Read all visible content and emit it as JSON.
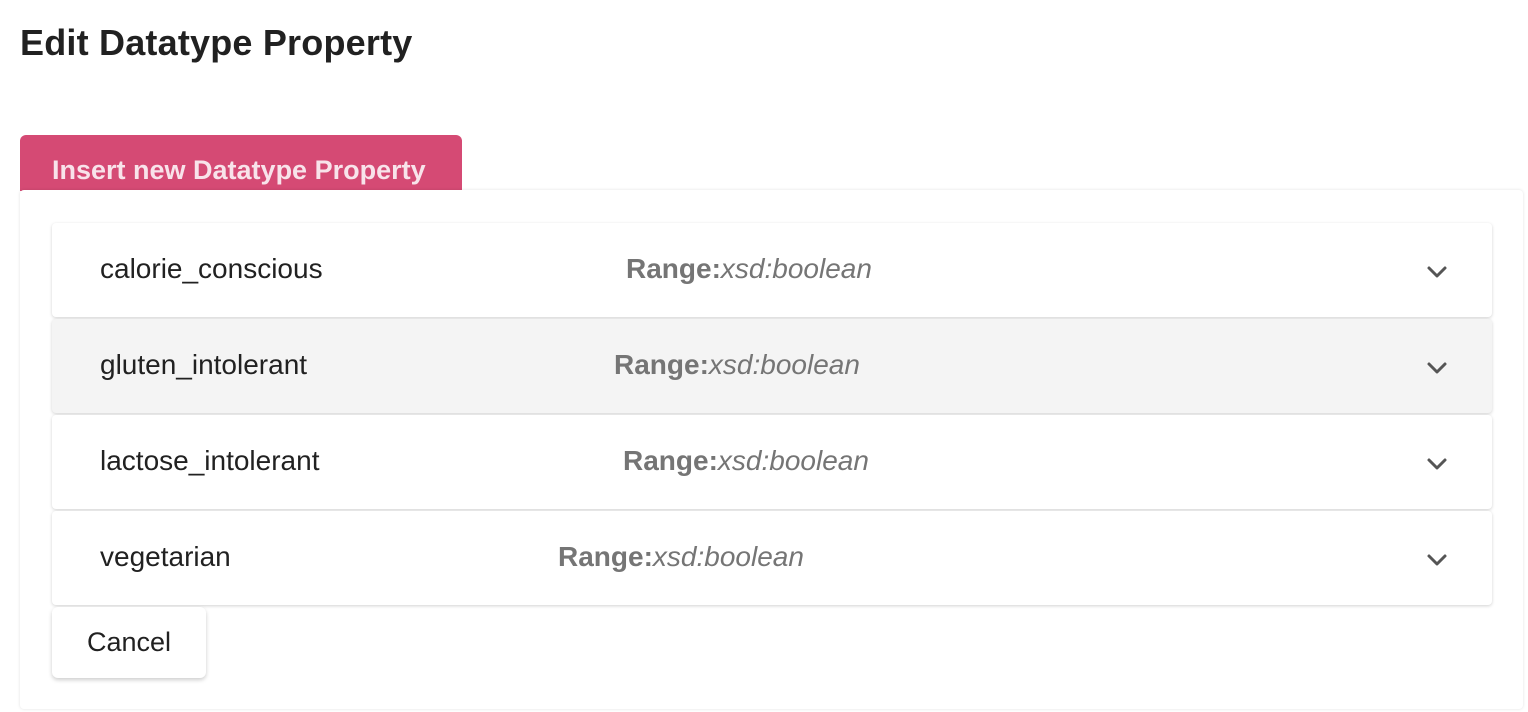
{
  "header": {
    "title": "Edit Datatype Property"
  },
  "toolbar": {
    "insert_label": "Insert new Datatype Property"
  },
  "properties": [
    {
      "name": "calorie_conscious",
      "range_label": "Range:",
      "range_value": "xsd:boolean",
      "icon": "chevron-down-icon"
    },
    {
      "name": "gluten_intolerant",
      "range_label": "Range:",
      "range_value": "xsd:boolean",
      "icon": "chevron-down-icon"
    },
    {
      "name": "lactose_intolerant",
      "range_label": "Range:",
      "range_value": "xsd:boolean",
      "icon": "chevron-down-icon"
    },
    {
      "name": "vegetarian",
      "range_label": "Range:",
      "range_value": "xsd:boolean",
      "icon": "chevron-down-icon"
    }
  ],
  "footer": {
    "cancel_label": "Cancel"
  },
  "colors": {
    "accent": "#d54a74",
    "accent_text": "#f8e3ea",
    "range_text": "#757575",
    "hover_row": "#f4f4f4"
  }
}
